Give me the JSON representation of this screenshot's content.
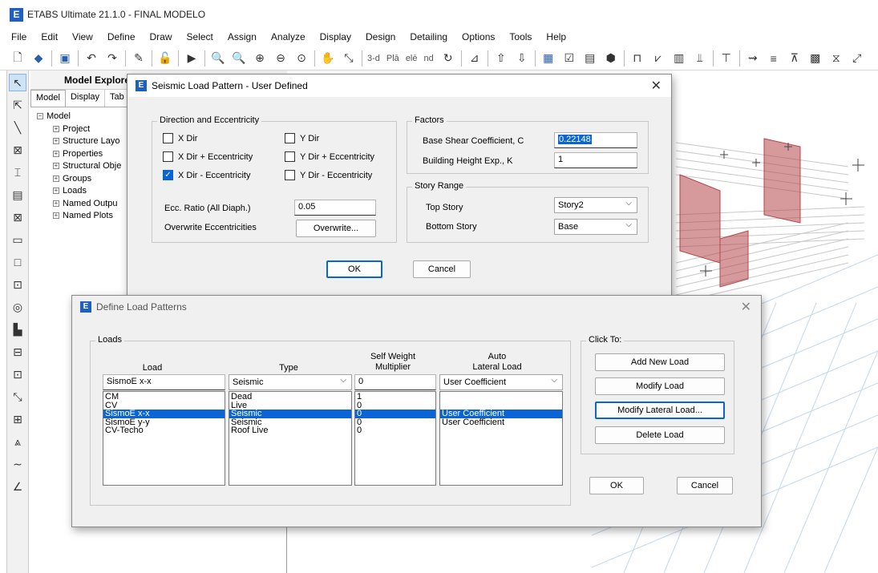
{
  "app": {
    "icon_letter": "E",
    "title": "ETABS Ultimate 21.1.0 - FINAL MODELO"
  },
  "menu": [
    "File",
    "Edit",
    "View",
    "Define",
    "Draw",
    "Select",
    "Assign",
    "Analyze",
    "Display",
    "Design",
    "Detailing",
    "Options",
    "Tools",
    "Help"
  ],
  "toolbar": {
    "text_3d": "3-d",
    "text_pla": "Plā",
    "text_ele": "elē",
    "text_nd": "nd"
  },
  "explorer": {
    "title": "Model Explore",
    "tabs": [
      "Model",
      "Display",
      "Tab"
    ],
    "root": "Model",
    "items": [
      "Project",
      "Structure Layo",
      "Properties",
      "Structural Obje",
      "Groups",
      "Loads",
      "Named Outpu",
      "Named Plots"
    ]
  },
  "seismic_dialog": {
    "title": "Seismic Load Pattern - User Defined",
    "direction_group": "Direction and Eccentricity",
    "x_dir": "X Dir",
    "x_dir_plus": "X Dir + Eccentricity",
    "x_dir_minus": "X Dir - Eccentricity",
    "y_dir": "Y Dir",
    "y_dir_plus": "Y Dir + Eccentricity",
    "y_dir_minus": "Y Dir - Eccentricity",
    "ecc_ratio_label": "Ecc. Ratio (All Diaph.)",
    "ecc_ratio_value": "0.05",
    "overwrite_label": "Overwrite Eccentricities",
    "overwrite_button": "Overwrite...",
    "factors_group": "Factors",
    "base_shear_label": "Base Shear Coefficient, C",
    "base_shear_value": "0.22148",
    "height_exp_label": "Building Height Exp., K",
    "height_exp_value": "1",
    "story_range_group": "Story Range",
    "top_story_label": "Top Story",
    "top_story_value": "Story2",
    "bottom_story_label": "Bottom Story",
    "bottom_story_value": "Base",
    "ok": "OK",
    "cancel": "Cancel"
  },
  "load_dialog": {
    "title": "Define Load Patterns",
    "loads_group": "Loads",
    "col_load": "Load",
    "col_type": "Type",
    "col_selfweight_1": "Self Weight",
    "col_selfweight_2": "Multiplier",
    "col_auto_1": "Auto",
    "col_auto_2": "Lateral Load",
    "edit_load": "SismoE x-x",
    "edit_type": "Seismic",
    "edit_multiplier": "0",
    "edit_lateral": "User Coefficient",
    "rows": [
      {
        "load": "CM",
        "type": "Dead",
        "mult": "1",
        "lateral": ""
      },
      {
        "load": "CV",
        "type": "Live",
        "mult": "0",
        "lateral": ""
      },
      {
        "load": "SismoE x-x",
        "type": "Seismic",
        "mult": "0",
        "lateral": "User Coefficient"
      },
      {
        "load": "SismoE y-y",
        "type": "Seismic",
        "mult": "0",
        "lateral": "User Coefficient"
      },
      {
        "load": "CV-Techo",
        "type": "Roof Live",
        "mult": "0",
        "lateral": ""
      }
    ],
    "click_to": "Click To:",
    "add_new": "Add New Load",
    "modify": "Modify Load",
    "modify_lateral": "Modify Lateral Load...",
    "delete": "Delete Load",
    "ok": "OK",
    "cancel": "Cancel"
  },
  "colors": {
    "accent": "#0a64d6",
    "brand": "#1f5fbf",
    "wall": "#b5474a"
  }
}
